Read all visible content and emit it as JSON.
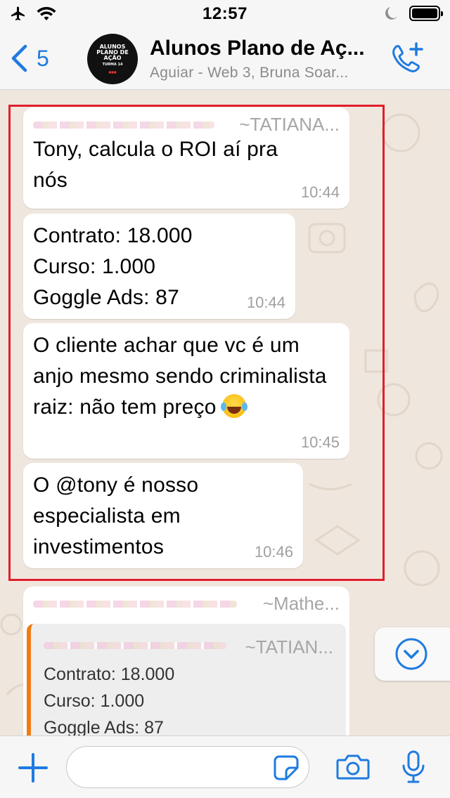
{
  "status_bar": {
    "time": "12:57"
  },
  "header": {
    "back_count": "5",
    "title": "Alunos Plano de Aç...",
    "subtitle": "Aguiar - Web 3, Bruna Soar...",
    "avatar_lines": [
      "ALUNOS",
      "PLANO DE AÇÃO",
      "TURMA 14"
    ]
  },
  "messages": [
    {
      "sender": "~TATIANA...",
      "text": "Tony, calcula o ROI aí pra nós",
      "time": "10:44"
    },
    {
      "lines": [
        "Contrato: 18.000",
        "Curso: 1.000",
        "Goggle Ads: 87"
      ],
      "time": "10:44"
    },
    {
      "text": "O cliente achar que vc é um anjo mesmo sendo criminalista raiz: não tem preço",
      "time": "10:45"
    },
    {
      "text": "O @tony é nosso especialista em investimentos",
      "time": "10:46"
    }
  ],
  "partial_message": {
    "sender": "~Mathe...",
    "quote": {
      "sender": "~TATIAN...",
      "lines": [
        "Contrato: 18.000",
        "Curso: 1.000",
        "Goggle Ads: 87"
      ]
    }
  },
  "composer": {
    "value": ""
  },
  "colors": {
    "accent": "#1f7be0",
    "chat_background": "#efe7de",
    "highlight_border": "#e01e2b",
    "quote_bar": "#f07b14"
  },
  "icons": {
    "status_left": [
      "airplane-icon",
      "wifi-icon"
    ],
    "status_right": [
      "moon-icon",
      "battery-icon"
    ],
    "header": [
      "chevron-left-icon",
      "add-call-icon"
    ],
    "bottom": [
      "plus-icon",
      "sticker-icon",
      "camera-icon",
      "microphone-icon"
    ],
    "scroll": "chevron-down-circle-icon"
  }
}
